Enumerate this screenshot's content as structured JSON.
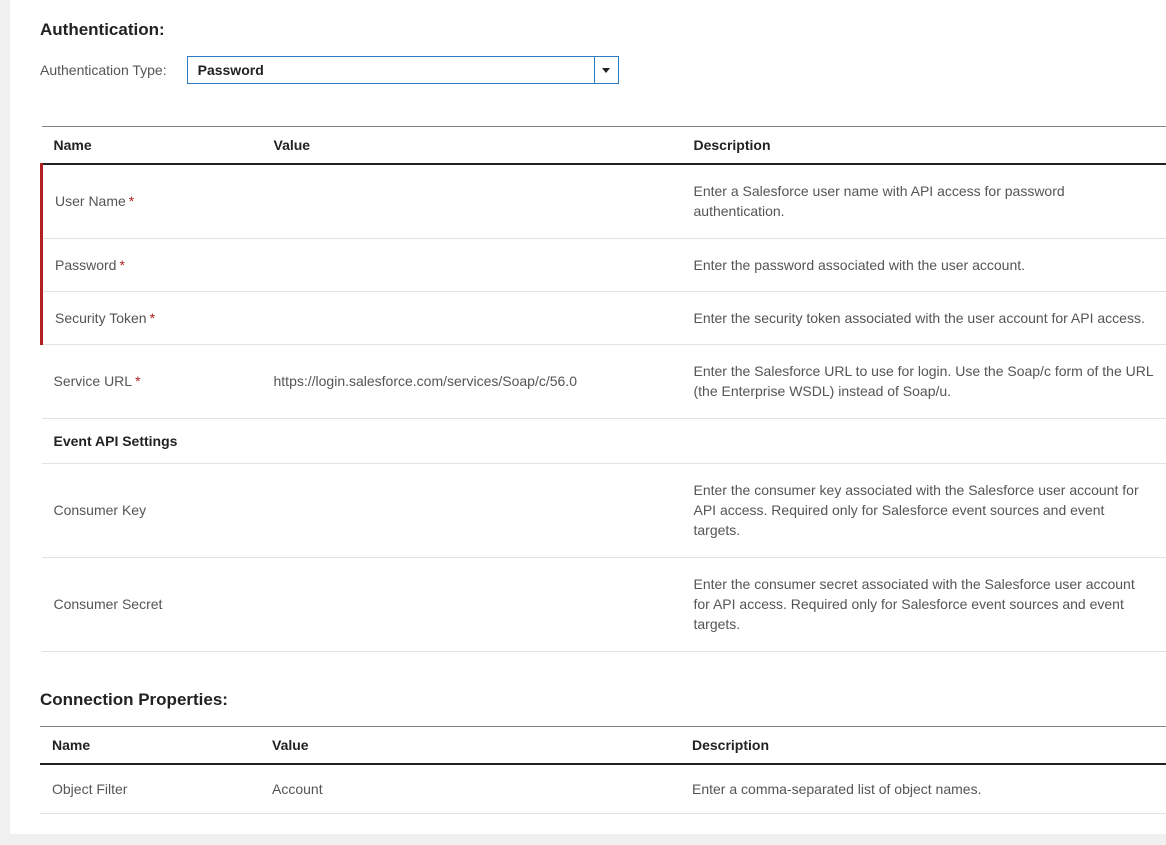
{
  "authentication": {
    "heading": "Authentication:",
    "type_label": "Authentication Type:",
    "type_selected": "Password"
  },
  "columns": {
    "name": "Name",
    "value": "Value",
    "description": "Description"
  },
  "auth_rows": [
    {
      "name": "User Name",
      "required": true,
      "red_marker": true,
      "value": "",
      "description": "Enter a Salesforce user name with API access for password authentication."
    },
    {
      "name": "Password",
      "required": true,
      "red_marker": true,
      "value": "",
      "description": "Enter the password associated with the user account."
    },
    {
      "name": "Security Token",
      "required": true,
      "red_marker": true,
      "value": "",
      "description": "Enter the security token associated with the user account for API access."
    },
    {
      "name": "Service URL",
      "required": true,
      "red_marker": false,
      "value": "https://login.salesforce.com/services/Soap/c/56.0",
      "description": "Enter the Salesforce URL to use for login.  Use the Soap/c form of the URL (the Enterprise WSDL) instead of Soap/u."
    },
    {
      "section": "Event API Settings"
    },
    {
      "name": "Consumer Key",
      "required": false,
      "red_marker": false,
      "value": "",
      "description": "Enter the consumer key associated with the Salesforce user account for API access. Required only for Salesforce event sources and event targets."
    },
    {
      "name": "Consumer Secret",
      "required": false,
      "red_marker": false,
      "value": "",
      "description": "Enter the consumer secret associated with the Salesforce user account for API access. Required only for Salesforce event sources and event targets."
    }
  ],
  "connection_properties": {
    "heading": "Connection Properties:",
    "rows": [
      {
        "name": "Object Filter",
        "value": "Account",
        "description": "Enter a comma-separated list of object names."
      }
    ]
  }
}
